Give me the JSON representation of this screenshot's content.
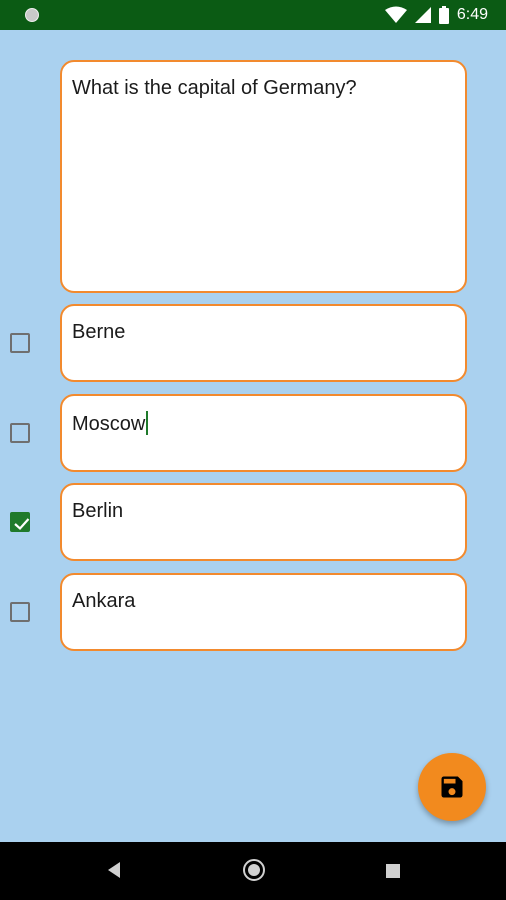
{
  "status_bar": {
    "time": "6:49",
    "icons": [
      "notification-dot-icon",
      "wifi-icon",
      "signal-icon",
      "battery-icon"
    ]
  },
  "question": {
    "text": "What is the capital of Germany?"
  },
  "answers": [
    {
      "text": "Berne",
      "checked": false
    },
    {
      "text": "Moscow",
      "checked": false,
      "focused": true
    },
    {
      "text": "Berlin",
      "checked": true
    },
    {
      "text": "Ankara",
      "checked": false
    }
  ],
  "fab": {
    "icon": "save-icon",
    "color": "#f28a1e"
  },
  "colors": {
    "status_bar": "#0b5b14",
    "background": "#aad1ef",
    "field_border": "#f28a2e",
    "checkbox_checked": "#1f7a2b"
  },
  "nav_bar": {
    "icons": [
      "back-icon",
      "home-icon",
      "recents-icon"
    ]
  }
}
